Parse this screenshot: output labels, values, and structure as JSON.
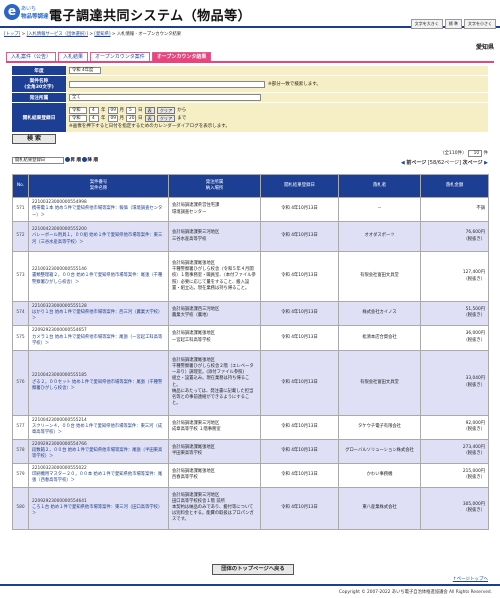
{
  "header": {
    "logo_mark": "e",
    "logo_line1": "あいち",
    "logo_line2": "物品等調達",
    "title": "電子調達共同システム（物品等）",
    "font_buttons": [
      "文字を大きく",
      "標 準",
      "文字を小さく"
    ]
  },
  "breadcrumb": {
    "items": [
      "[トップ]",
      "[入札情報サービス（団体選択）]",
      "[愛知県]"
    ],
    "current": "入札情報 - オープンカウンタ結果"
  },
  "region": "愛知県",
  "tabs": [
    "入札案件（公告）",
    "入札結果",
    "オープンカウンタ案件",
    "オープンカウンタ結果"
  ],
  "search": {
    "fiscal_year_label": "年度",
    "fiscal_year_value": "令和 4年度",
    "case_name_label": "案件名称",
    "case_name_sub": "(全角30文字)",
    "case_name_note": "※部分一致で検索します。",
    "orderer_label": "発注所属",
    "orderer_value": "全て",
    "date_label": "開札結果登録日",
    "era": "令和",
    "from": {
      "y": "4",
      "m": "09",
      "d": "5"
    },
    "to": {
      "y": "4",
      "m": "09",
      "d": "20"
    },
    "year_unit": "年",
    "month_unit": "月",
    "day_unit": "日",
    "calendar_btn": "表",
    "clear_btn": "クリア",
    "from_word": "から",
    "to_word": "まで",
    "date_note": "※画像を押下すると日付を指定するためのカレンダーダイアログを表示します。",
    "search_btn": "検 索"
  },
  "controls": {
    "sort_value": "開札結果登録日",
    "asc_label": "昇 順",
    "desc_label": "降 順",
    "total": "（全110件）",
    "per_page": "10",
    "per_page_unit": "件",
    "prev": "前ページ",
    "page_info": "[58/62ページ]",
    "next": "次ページ"
  },
  "table": {
    "headers": {
      "no": "No.",
      "case": "案件番号\n案件名称",
      "dept": "発注所属\n納入場所",
      "date": "開札結果登録日",
      "winner": "落札者",
      "amount": "落札金額"
    },
    "rows": [
      {
        "no": "571",
        "id": "22100323000000554998",
        "name": "携帯電１本 始め５件で愛知県他市場等案件：報価（環境調査センター）＞",
        "dept": "会計局調達課県営住宅課\n環境調査センター",
        "date": "令和 4年10月13日",
        "winner": "－",
        "amount": "不調",
        "tax": ""
      },
      {
        "no": "572",
        "id": "22100423000000555200",
        "name": "バレーボール用具１，００組 始め１件で愛知県他市場等案件：東三河（三谷水産高等学校）＞",
        "dept": "会計局調達課東三河地区\n三谷水産高等学校",
        "date": "令和 4年10月13日",
        "winner": "オオダスポーツ",
        "amount": "76,600円",
        "tax": "（税抜き）"
      },
      {
        "no": "573",
        "id": "22100323000000555146",
        "name": "書類整理箱２，００台 始め１件で愛知県他市場等案件：尾張（千種警察署ひがしら校舎）＞",
        "dept": "会計局調達課尾張地区\n千種警察署ひがしら校舎（令和５年４月開校）１階事務室・職員室、（本付ファイル参照）必要に応じて量をすること、搬入設置・組立込。現在業務は持ち帰ること。",
        "date": "令和 4年10月13日",
        "winner": "有限会社富田文具堂",
        "amount": "127,400円",
        "tax": "（税抜き）"
      },
      {
        "no": "574",
        "id": "22100323000000555128",
        "name": "はかり１台 始め１件で愛知県他市場等案件：西三河（農業大学校）＞",
        "dept": "会計局調達課西三河地区\n農業大学校（農地）",
        "date": "令和 4年10月13日",
        "winner": "株式会社カイノス",
        "amount": "51,500円",
        "tax": "（税抜き）"
      },
      {
        "no": "575",
        "id": "22092923000000554657",
        "name": "カメラ１台 始め１件で愛知県他市場等案件：尾張（一宮起工科高等学校）＞",
        "dept": "会計局調達課尾張地区\n一宮起工科高等学校",
        "date": "令和 4年10月13日",
        "winner": "松清本店合資会社",
        "amount": "36,000円",
        "tax": "（税抜き）"
      },
      {
        "no": "576",
        "id": "22100423000000555185",
        "name": "ざる２，００セット 始め１件で愛知県他市場等案件：尾張（千種警察署ひがしら校舎）＞",
        "dept": "会計局調達課尾張地区\n千種警察署ひがしら校舎２階（エレベーターあり）調理室。(添付ファイル参照)\n組立・設置込み。現在業務は持ち帰ること。\n納品にあたっては、発注書に記載した担当名等との事前連絡ができるようにすること。",
        "date": "令和 4年10月13日",
        "winner": "有限会社富田文具堂",
        "amount": "33,040円",
        "tax": "（税抜き）"
      },
      {
        "no": "577",
        "id": "22100423000000555214",
        "name": "スクリーン４，００台 始め１件で愛知県他市場等案件：東三河（成章高等学校）＞",
        "dept": "会計局調達課東三河地区\n成章高等学校 １階事務室",
        "date": "令和 4年10月13日",
        "winner": "タケウチ電子有限会社",
        "amount": "92,000円",
        "tax": "（税抜き）"
      },
      {
        "no": "578",
        "id": "22092923000000554766",
        "name": "段数箱２，００台 始め１件で愛知県他市場等案件：尾張（半田東高等学校）＞",
        "dept": "会計局調達課尾張地区\n半田東高等学校",
        "date": "令和 4年10月13日",
        "winner": "グローバルソリューション株式会社",
        "amount": "273,400円",
        "tax": "（税抜き）"
      },
      {
        "no": "579",
        "id": "22100323000000555022",
        "name": "印刷機用マスター２０，００本 始め１件で愛知県他市場等案件：尾張（西春高等学校）＞",
        "dept": "会計局調達課尾張地区\n西春高等学校",
        "date": "令和 4年10月13日",
        "winner": "かわい事務機",
        "amount": "215,000円",
        "tax": "（税抜き）"
      },
      {
        "no": "580",
        "id": "22092923000000554641",
        "name": "ころ１台 始め１件で愛知県他市場等案件：東三河（田口高等学校）＞",
        "dept": "会計局調達課東三河地区\n田口高等学校校舎１階 前所\n本契約は納品のみであり、搬付等については別料金とする。能費の取扱はプロパンガスです。",
        "date": "令和 4年10月13日",
        "winner": "東八産業株式会社",
        "amount": "305,000円",
        "tax": "（税抜き）"
      }
    ]
  },
  "back_button": "団体のトップページへ戻る",
  "page_top": "↑ページトップへ",
  "copyright": "Copyright © 2007-2022 あいち電子自治体推進協議会 All Rights Reserved."
}
